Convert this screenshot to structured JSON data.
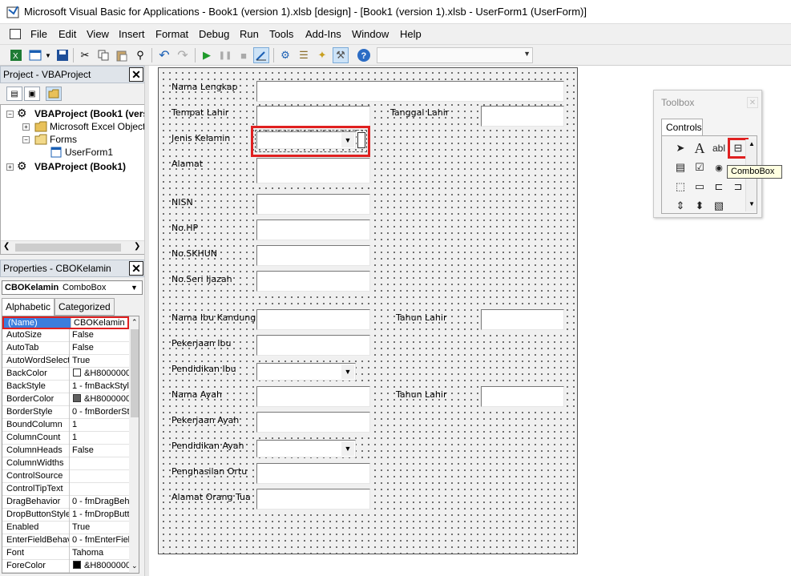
{
  "window": {
    "title": "Microsoft Visual Basic for Applications - Book1 (version 1).xlsb [design] - [Book1 (version 1).xlsb - UserForm1 (UserForm)]"
  },
  "menu": [
    "File",
    "Edit",
    "View",
    "Insert",
    "Format",
    "Debug",
    "Run",
    "Tools",
    "Add-Ins",
    "Window",
    "Help"
  ],
  "toolbar_icons": [
    "excel-icon",
    "insert-userform-icon",
    "save-icon",
    "cut-icon",
    "copy-icon",
    "paste-icon",
    "find-icon",
    "undo-icon",
    "redo-icon",
    "run-icon",
    "break-icon",
    "reset-icon",
    "design-mode-icon",
    "project-explorer-icon",
    "properties-icon",
    "object-browser-icon",
    "toolbox-icon",
    "help-icon"
  ],
  "project": {
    "title": "Project - VBAProject",
    "tree": [
      {
        "label": "VBAProject (Book1 (vers",
        "bold": true
      },
      {
        "label": "Microsoft Excel Objects",
        "bold": false
      },
      {
        "label": "Forms",
        "bold": false
      },
      {
        "label": "UserForm1",
        "bold": false
      },
      {
        "label": "VBAProject (Book1)",
        "bold": true
      }
    ]
  },
  "properties": {
    "title": "Properties - CBOKelamin",
    "object_name": "CBOKelamin",
    "object_type": "ComboBox",
    "tabs": [
      "Alphabetic",
      "Categorized"
    ],
    "rows": [
      {
        "name": "(Name)",
        "value": "CBOKelamin",
        "swatch": ""
      },
      {
        "name": "AutoSize",
        "value": "False",
        "swatch": ""
      },
      {
        "name": "AutoTab",
        "value": "False",
        "swatch": ""
      },
      {
        "name": "AutoWordSelect",
        "value": "True",
        "swatch": ""
      },
      {
        "name": "BackColor",
        "value": "&H8000000",
        "swatch": "#ffffff"
      },
      {
        "name": "BackStyle",
        "value": "1 - fmBackStyle",
        "swatch": ""
      },
      {
        "name": "BorderColor",
        "value": "&H8000000",
        "swatch": "#606060"
      },
      {
        "name": "BorderStyle",
        "value": "0 - fmBorderSt",
        "swatch": ""
      },
      {
        "name": "BoundColumn",
        "value": "1",
        "swatch": ""
      },
      {
        "name": "ColumnCount",
        "value": "1",
        "swatch": ""
      },
      {
        "name": "ColumnHeads",
        "value": "False",
        "swatch": ""
      },
      {
        "name": "ColumnWidths",
        "value": "",
        "swatch": ""
      },
      {
        "name": "ControlSource",
        "value": "",
        "swatch": ""
      },
      {
        "name": "ControlTipText",
        "value": "",
        "swatch": ""
      },
      {
        "name": "DragBehavior",
        "value": "0 - fmDragBeh",
        "swatch": ""
      },
      {
        "name": "DropButtonStyle",
        "value": "1 - fmDropButt",
        "swatch": ""
      },
      {
        "name": "Enabled",
        "value": "True",
        "swatch": ""
      },
      {
        "name": "EnterFieldBehav",
        "value": "0 - fmEnterFiel",
        "swatch": ""
      },
      {
        "name": "Font",
        "value": "Tahoma",
        "swatch": ""
      },
      {
        "name": "ForeColor",
        "value": "&H8000000",
        "swatch": "#000000"
      }
    ]
  },
  "form": {
    "labels": [
      {
        "text": "Nama Lengkap",
        "col": 1,
        "row": 0
      },
      {
        "text": "Tempat Lahir",
        "col": 1,
        "row": 1
      },
      {
        "text": "Tanggal Lahir",
        "col": 2,
        "row": 1
      },
      {
        "text": "Jenis Kelamin",
        "col": 1,
        "row": 2
      },
      {
        "text": "Alamat",
        "col": 1,
        "row": 3
      },
      {
        "text": "NISN",
        "col": 1,
        "row": 4
      },
      {
        "text": "No.HP",
        "col": 1,
        "row": 5
      },
      {
        "text": "No.SKHUN",
        "col": 1,
        "row": 6
      },
      {
        "text": "No.Seri Ijazah",
        "col": 1,
        "row": 7
      },
      {
        "text": "Nama Ibu Kandung",
        "col": 1,
        "row": 8
      },
      {
        "text": "Tahun Lahir",
        "col": 2,
        "row": 8
      },
      {
        "text": "Pekerjaan Ibu",
        "col": 1,
        "row": 9
      },
      {
        "text": "Pendidikan Ibu",
        "col": 1,
        "row": 10
      },
      {
        "text": "Nama Ayah",
        "col": 1,
        "row": 11
      },
      {
        "text": "Tahun Lahir",
        "col": 2,
        "row": 11
      },
      {
        "text": "Pekerjaan Ayah",
        "col": 1,
        "row": 12
      },
      {
        "text": "Pendidikan Ayah",
        "col": 1,
        "row": 13
      },
      {
        "text": "Penghasilan Ortu",
        "col": 1,
        "row": 14
      },
      {
        "text": "Alamat Orang Tua",
        "col": 1,
        "row": 15
      }
    ]
  },
  "toolbox": {
    "title": "Toolbox",
    "tab": "Controls",
    "tools": [
      "select-objects-icon",
      "label-icon",
      "textbox-icon",
      "combobox-icon",
      "listbox-icon",
      "checkbox-icon",
      "optionbutton-icon",
      "togglebutton-icon",
      "frame-icon",
      "commandbutton-icon",
      "tabstrip-icon",
      "multipage-icon",
      "scrollbar-icon",
      "spinbutton-icon",
      "image-icon"
    ],
    "tooltip": "ComboBox"
  }
}
